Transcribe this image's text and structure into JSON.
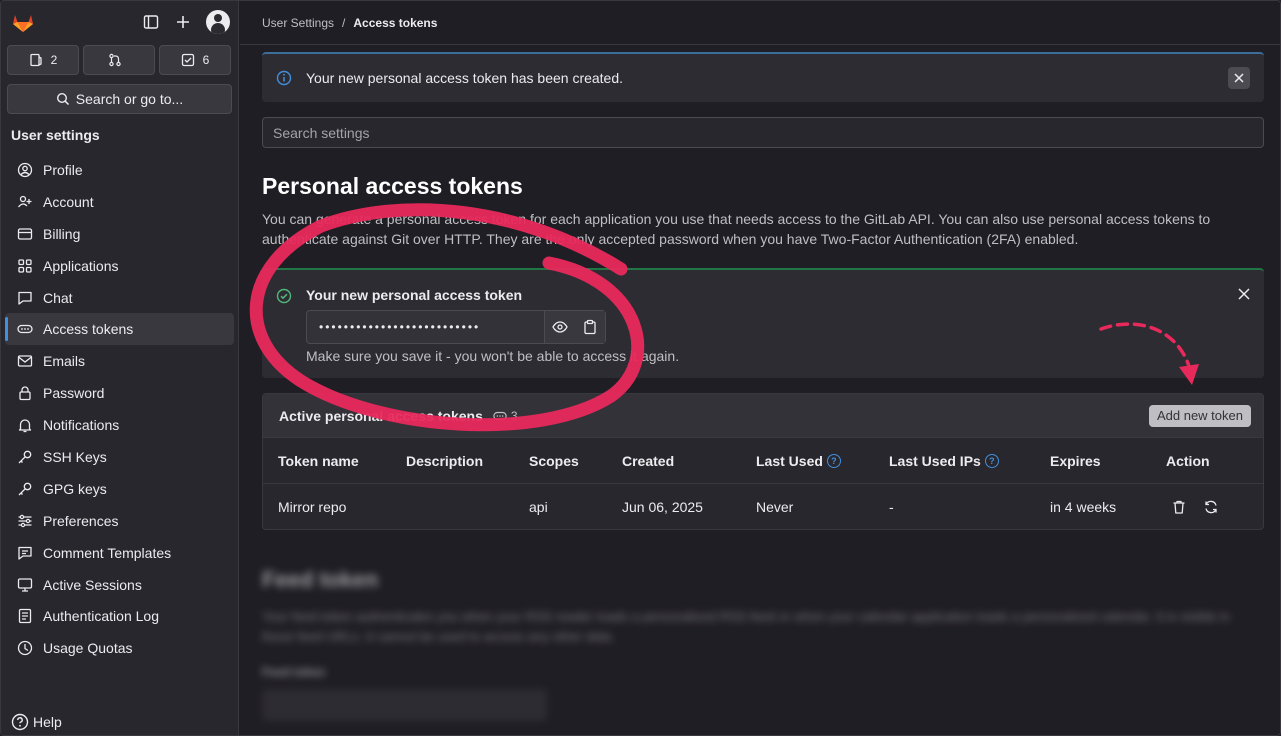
{
  "sidebar": {
    "counters": [
      {
        "icon": "issues-icon",
        "count": "2"
      },
      {
        "icon": "merge-request-icon",
        "count": ""
      },
      {
        "icon": "todo-icon",
        "count": "6"
      }
    ],
    "search_label": "Search or go to...",
    "heading": "User settings",
    "items": [
      {
        "label": "Profile",
        "icon": "profile-icon"
      },
      {
        "label": "Account",
        "icon": "account-icon"
      },
      {
        "label": "Billing",
        "icon": "billing-icon"
      },
      {
        "label": "Applications",
        "icon": "applications-icon"
      },
      {
        "label": "Chat",
        "icon": "chat-icon"
      },
      {
        "label": "Access tokens",
        "icon": "token-icon",
        "active": true
      },
      {
        "label": "Emails",
        "icon": "mail-icon"
      },
      {
        "label": "Password",
        "icon": "lock-icon"
      },
      {
        "label": "Notifications",
        "icon": "bell-icon"
      },
      {
        "label": "SSH Keys",
        "icon": "key-icon"
      },
      {
        "label": "GPG keys",
        "icon": "key-icon"
      },
      {
        "label": "Preferences",
        "icon": "preferences-icon"
      },
      {
        "label": "Comment Templates",
        "icon": "comment-icon"
      },
      {
        "label": "Active Sessions",
        "icon": "monitor-icon"
      },
      {
        "label": "Authentication Log",
        "icon": "log-icon"
      },
      {
        "label": "Usage Quotas",
        "icon": "quota-icon"
      }
    ],
    "help": "Help"
  },
  "breadcrumb": {
    "parent": "User Settings",
    "separator": "/",
    "current": "Access tokens"
  },
  "alert": {
    "message": "Your new personal access token has been created."
  },
  "search": {
    "placeholder": "Search settings"
  },
  "page": {
    "title": "Personal access tokens",
    "description": "You can generate a personal access token for each application you use that needs access to the GitLab API. You can also use personal access tokens to authenticate against Git over HTTP. They are the only accepted password when you have Two-Factor Authentication (2FA) enabled."
  },
  "new_token": {
    "title": "Your new personal access token",
    "masked_value": "••••••••••••••••••••••••••",
    "note": "Make sure you save it - you won't be able to access it again."
  },
  "tokens": {
    "title": "Active personal access tokens",
    "count": "3",
    "add_button": "Add new token",
    "columns": [
      "Token name",
      "Description",
      "Scopes",
      "Created",
      "Last Used",
      "Last Used IPs",
      "Expires",
      "Action"
    ],
    "rows": [
      {
        "name": "Mirror repo",
        "description": "",
        "scopes": "api",
        "created": "Jun 06, 2025",
        "last_used": "Never",
        "last_used_ips": "-",
        "expires": "in 4 weeks"
      }
    ]
  },
  "feed": {
    "title": "Feed token",
    "description": "Your feed token authenticates you when your RSS reader loads a personalized RSS feed or when your calendar application loads a personalized calendar. It is visible in those feed URLs. It cannot be used to access any other data.",
    "label": "Feed token"
  },
  "colors": {
    "accent": "#428fdc",
    "annotation": "#e8295c",
    "success": "#217645"
  }
}
